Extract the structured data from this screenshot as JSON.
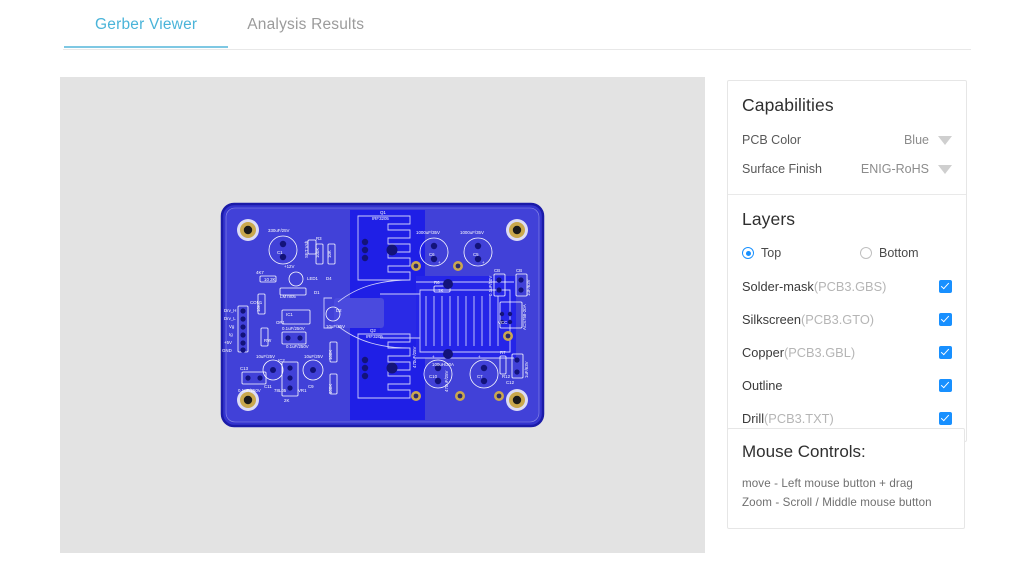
{
  "tabs": [
    {
      "label": "Gerber Viewer",
      "active": true
    },
    {
      "label": "Analysis Results",
      "active": false
    }
  ],
  "capabilities": {
    "title": "Capabilities",
    "rows": [
      {
        "label": "PCB Color",
        "value": "Blue",
        "icon": "chevron-down-icon"
      },
      {
        "label": "Surface Finish",
        "value": "ENIG-RoHS",
        "icon": "chevron-down-icon"
      }
    ]
  },
  "layers": {
    "title": "Layers",
    "side_options": [
      {
        "label": "Top",
        "selected": true
      },
      {
        "label": "Bottom",
        "selected": false
      }
    ],
    "items": [
      {
        "name": "Solder-mask",
        "file": "(PCB3.GBS)",
        "checked": true
      },
      {
        "name": "Silkscreen",
        "file": "(PCB3.GTO)",
        "checked": true
      },
      {
        "name": "Copper",
        "file": "(PCB3.GBL)",
        "checked": true
      },
      {
        "name": "Outline",
        "file": "",
        "checked": true
      },
      {
        "name": "Drill",
        "file": "(PCB3.TXT)",
        "checked": true
      }
    ]
  },
  "mouse_controls": {
    "title": "Mouse Controls:",
    "lines": [
      "move - Left mouse button + drag",
      "Zoom - Scroll / Middle mouse button"
    ]
  },
  "viewer": {
    "background": "#e3e3e3",
    "board_color": "#2f2fd6",
    "silkscreen_color": "#ffffff",
    "pad_color": "#d4b15a",
    "copper_color": "#1a1ae8"
  },
  "board_silkscreen": {
    "designators": [
      "Q1",
      "IRF3205",
      "Q2",
      "IRF3205",
      "C1",
      "330uF/25V",
      "C6",
      "1000uF/35V",
      "C5",
      "1000uF/35V",
      "C10",
      "C7",
      "470uF/25V",
      "C11",
      "10uF/25V",
      "C9",
      "10uF/25V",
      "C13",
      "0.1uF/250V",
      "C8",
      "0.1uF/250V",
      "C2",
      "10uF/25V",
      "R1",
      "R3",
      "R4",
      "R5",
      "R6",
      "R7",
      "R8",
      "R9",
      "R10",
      "R12",
      "RW",
      "RV",
      "1K",
      "10K",
      "100K",
      "4K7",
      "LM7805",
      "IC1",
      "IC2",
      "78L05",
      "LED1",
      "+12V",
      "+5V",
      "CON1",
      "Drv_H",
      "Drv_L",
      "Vg",
      "Ig",
      "+5V",
      "GND",
      "VR1",
      "2K",
      "SET Vsh",
      "100uH/20A",
      "D1",
      "D2",
      "D4",
      "CB",
      "CB",
      "C12",
      "VCC",
      "ACS758-20A"
    ]
  }
}
